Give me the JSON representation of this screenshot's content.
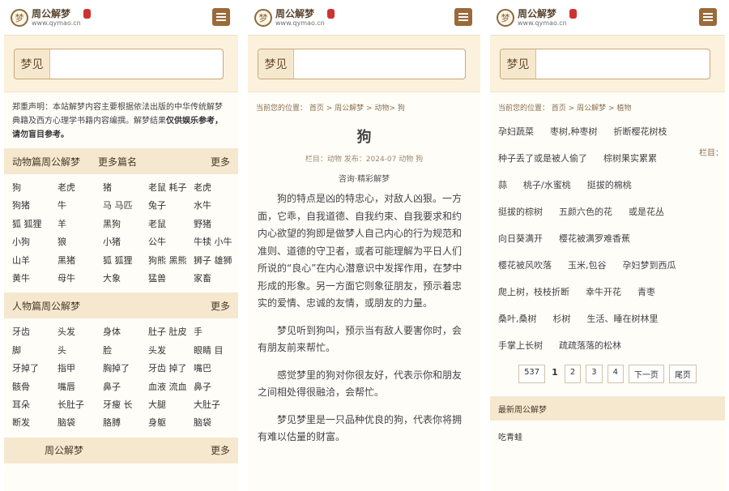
{
  "brand": {
    "title": "周公解梦",
    "url": "www.qymao.cn",
    "badge": "梦"
  },
  "search": {
    "label": "梦见",
    "placeholder": ""
  },
  "home": {
    "disclaimer_prefix": "郑重声明：本站解梦内容主要根据依法出版的中华传统解梦典籍及西方心理学书籍内容编撰。解梦结果",
    "disclaimer_bold": "仅供娱乐参考，请勿盲目参考。",
    "animal": {
      "title": "动物篇周公解梦",
      "sub": "更多篇名",
      "more": "更多",
      "items": [
        "狗",
        "老虎",
        "猪",
        "老鼠 耗子",
        "老虎",
        "狗猪",
        "牛",
        "马 马匹",
        "兔子",
        "水牛",
        "狐 狐狸",
        "羊",
        "黑狗",
        "老鼠",
        "野猪",
        "小狗",
        "狼",
        "小猪",
        "公牛",
        "牛犊 小牛",
        "山羊",
        "黑猪",
        "狐 狐狸",
        "狗熊 黑熊",
        "狮子 雄狮",
        "黄牛",
        "母牛",
        "大象",
        "猛兽",
        "家畜"
      ]
    },
    "people": {
      "title": "人物篇周公解梦",
      "more": "更多",
      "items": [
        "牙齿",
        "头发",
        "身体",
        "肚子 肚皮",
        "手",
        "脚",
        "头",
        "脸",
        "头发",
        "眼睛 目",
        "牙掉了",
        "指甲",
        "胸掉了",
        "牙齿 掉了",
        "嘴巴",
        "骸骨",
        "嘴唇",
        "鼻子",
        "血液 流血",
        "鼻子",
        "耳朵",
        "长肚子",
        "牙瘦 长",
        "大腿",
        "大肚子",
        "断发",
        "脑袋",
        "胳膊",
        "身躯",
        "脑袋"
      ]
    },
    "bottom": {
      "title": "周公解梦",
      "more": "更多"
    }
  },
  "article": {
    "breadcrumb": [
      "当前您的位置：",
      "首页",
      "周公解梦",
      "动物",
      "狗"
    ],
    "title": "狗",
    "meta": "栏目：动物 发布：2024-07 动物 狗",
    "author": "咨询·精彩解梦",
    "paragraphs": [
      "狗的特点是凶的特忠心，对敌人凶狠。一方面，它乖，自我道德、自我约束、自我要求和约内心欲望的狗即是做梦人自己内心的行为规范和准则、道德的守卫者，或者可能理解为平日人们所说的“良心”在内心潜意识中发挥作用，在梦中形成的形象。另一方面它则象征朋友，预示着忠实的爱情、忠诚的友情，或朋友的力量。",
      "梦见听到狗叫，预示当有敌人要害你时，会有朋友前来帮忙。",
      "感觉梦里的狗对你很友好，代表示你和朋友之间相处得很融洽，会帮忙。",
      "梦见梦里是一只品种优良的狗，代表你将拥有难以估量的财富。"
    ]
  },
  "plants": {
    "breadcrumb": [
      "当前您的位置：",
      "首页",
      "周公解梦",
      "植物"
    ],
    "cut_label": "栏目：",
    "rows": [
      [
        "孕妇蔬菜",
        "枣树,种枣树",
        "折断樱花树枝"
      ],
      [
        "种子丢了或是被人偷了",
        "棕树果实累累"
      ],
      [
        "蒜",
        "桃子/水蜜桃",
        "挺拔的棉桃"
      ],
      [
        "挺拔的棕树",
        "五颜六色的花",
        "或是花丛"
      ],
      [
        "向日葵满开",
        "樱花被满罗难香蕉"
      ],
      [
        "樱花被风吹落",
        "玉米,包谷",
        "孕妇梦到西瓜"
      ],
      [
        "爬上树，枝枝折断",
        "幸牛开花",
        "青枣"
      ],
      [
        "桑叶,桑树",
        "杉树",
        "生活、睡在树林里"
      ],
      [
        "手掌上长树",
        "疏疏落落的松林"
      ]
    ],
    "pager": {
      "total": "537",
      "current": "1",
      "pages": [
        "2",
        "3",
        "4"
      ],
      "next": "下一页",
      "last": "尾页"
    },
    "latest_title": "最新周公解梦",
    "latest_item": "吃青蛙"
  }
}
